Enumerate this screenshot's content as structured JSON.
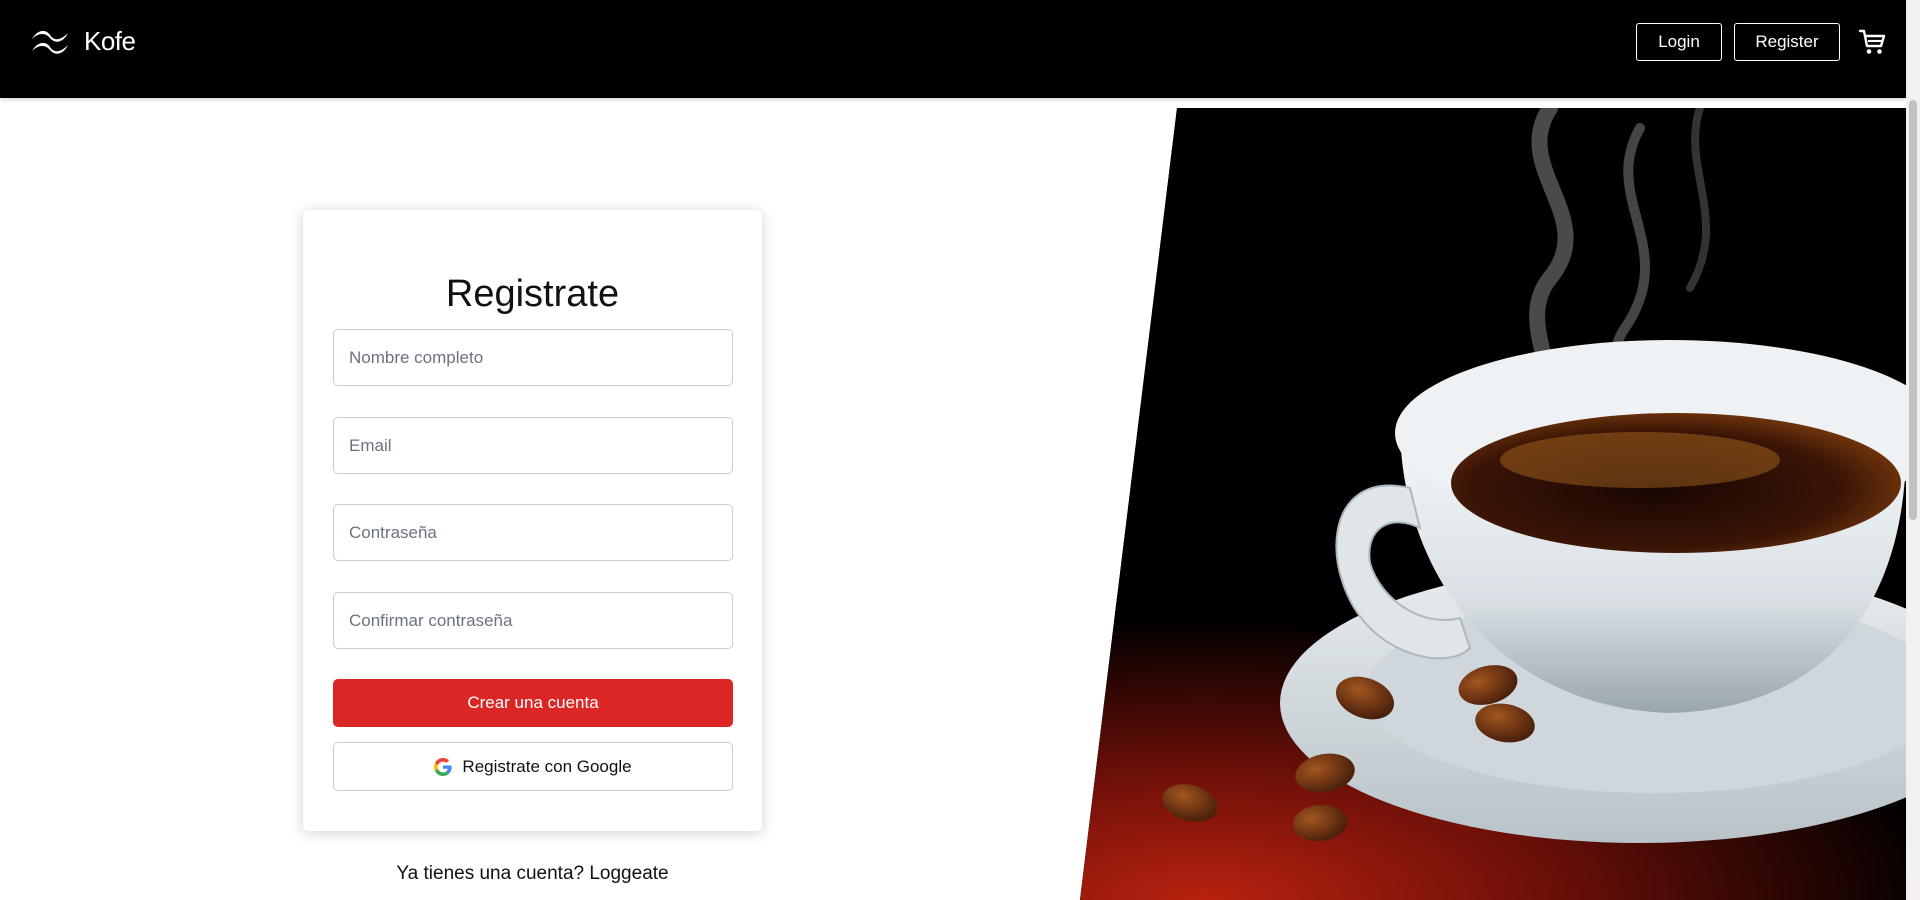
{
  "header": {
    "brand_name": "Kofe",
    "logo_icon": "tailwind-wave-icon",
    "login_label": "Login",
    "register_label": "Register",
    "cart_icon": "shopping-cart-icon"
  },
  "form": {
    "title": "Registrate",
    "fields": [
      {
        "name": "full-name",
        "placeholder": "Nombre completo",
        "value": ""
      },
      {
        "name": "email",
        "placeholder": "Email",
        "value": ""
      },
      {
        "name": "password",
        "placeholder": "Contraseña",
        "value": ""
      },
      {
        "name": "confirm-password",
        "placeholder": "Confirmar contraseña",
        "value": ""
      }
    ],
    "submit_label": "Crear una cuenta",
    "google_label": "Registrate con Google",
    "google_icon": "google-g-icon",
    "footer_prefix": "Ya tienes una cuenta?",
    "footer_link": "Loggeate"
  },
  "colors": {
    "header_bg": "#000000",
    "primary": "#dc2626",
    "card_bg": "#ffffff"
  },
  "hero": {
    "image": "coffee-cup-with-beans-photo"
  }
}
